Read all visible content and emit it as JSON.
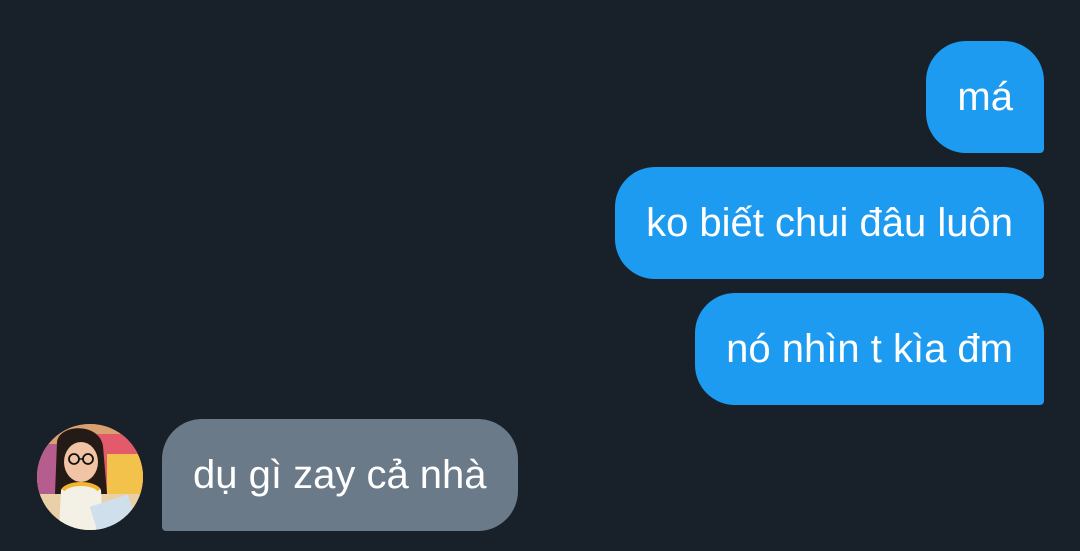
{
  "messages": [
    {
      "direction": "outgoing",
      "text": "má"
    },
    {
      "direction": "outgoing",
      "text": "ko biết chui đâu luôn"
    },
    {
      "direction": "outgoing",
      "text": "nó nhìn t kìa đm"
    },
    {
      "direction": "incoming",
      "text": "dụ gì zay cả nhà"
    }
  ],
  "colors": {
    "background": "#18202a",
    "outgoing_bubble": "#1d9bf0",
    "incoming_bubble": "#6b7a89",
    "text": "#ffffff"
  }
}
